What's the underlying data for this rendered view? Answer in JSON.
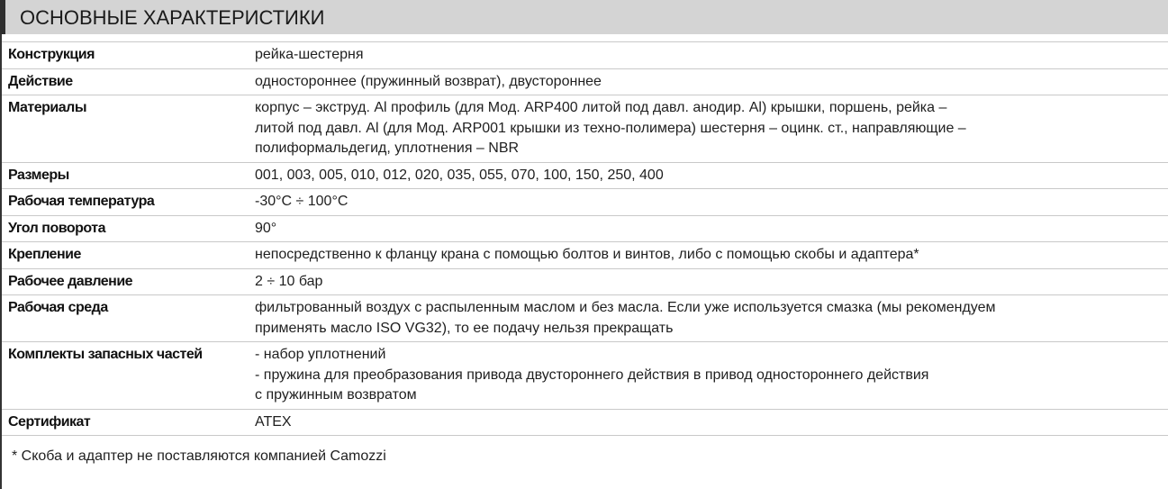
{
  "section": {
    "title": "ОСНОВНЫЕ ХАРАКТЕРИСТИКИ"
  },
  "specs": [
    {
      "label": "Конструкция",
      "value": "рейка-шестерня"
    },
    {
      "label": "Действие",
      "value": "одностороннее (пружинный возврат), двустороннее"
    },
    {
      "label": "Материалы",
      "value": "корпус – экструд. Al профиль (для Мод. ARP400 литой под давл. анодир. Al) крышки, поршень, рейка –\nлитой под давл. Al (для Мод. ARP001 крышки из техно-полимера) шестерня – оцинк. ст., направляющие –\nполиформальдегид, уплотнения – NBR"
    },
    {
      "label": "Размеры",
      "value": "001, 003, 005, 010, 012, 020, 035, 055, 070, 100, 150, 250, 400"
    },
    {
      "label": "Рабочая температура",
      "value": "-30°C ÷ 100°C"
    },
    {
      "label": "Угол поворота",
      "value": "90°"
    },
    {
      "label": "Крепление",
      "value": "непосредственно к фланцу крана с помощью болтов и винтов, либо с помощью скобы и адаптера*"
    },
    {
      "label": "Рабочее давление",
      "value": "2 ÷ 10 бар"
    },
    {
      "label": "Рабочая среда",
      "value": "фильтрованный воздух с распыленным маслом и без масла. Если уже используется смазка (мы рекомендуем\nприменять масло ISO VG32), то ее подачу нельзя прекращать"
    },
    {
      "label": "Комплекты запасных частей",
      "value": "- набор уплотнений\n- пружина для преобразования привода двустороннего действия в привод одностороннего действия\nс пружинным возвратом"
    },
    {
      "label": "Сертификат",
      "value": "ATEX"
    }
  ],
  "footnote": "* Скоба и адаптер не поставляются компанией Camozzi"
}
